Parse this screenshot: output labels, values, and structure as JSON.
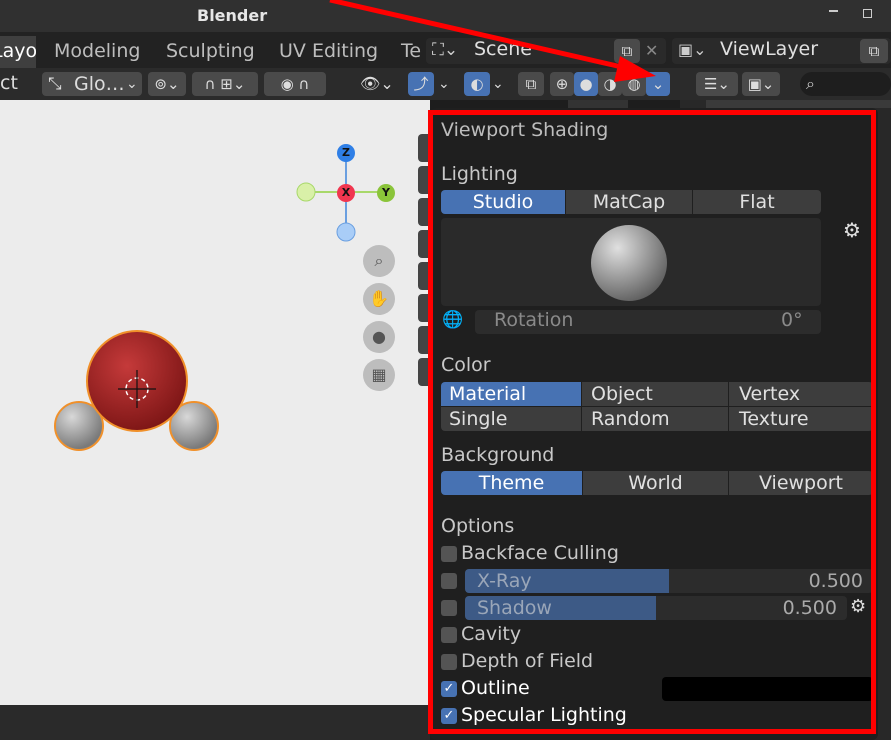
{
  "app": {
    "title": "Blender"
  },
  "workspaces": {
    "active_partial": "Layout",
    "tabs": [
      "Modeling",
      "Sculpting",
      "UV Editing",
      "Te"
    ]
  },
  "scene": {
    "name": "Scene",
    "view_layer": "ViewLayer"
  },
  "header": {
    "select_partial": "ct",
    "transform_orientation": "Glo…"
  },
  "gizmo": {
    "z": "Z",
    "x": "X",
    "y": "Y"
  },
  "popover": {
    "title": "Viewport Shading",
    "lighting": {
      "label": "Lighting",
      "options": [
        "Studio",
        "MatCap",
        "Flat"
      ],
      "selected": "Studio",
      "rotation_label": "Rotation",
      "rotation_value": "0°"
    },
    "color": {
      "label": "Color",
      "options_row1": [
        "Material",
        "Object",
        "Vertex"
      ],
      "options_row2": [
        "Single",
        "Random",
        "Texture"
      ],
      "selected": "Material"
    },
    "background": {
      "label": "Background",
      "options": [
        "Theme",
        "World",
        "Viewport"
      ],
      "selected": "Theme"
    },
    "options": {
      "label": "Options",
      "backface_culling": "Backface Culling",
      "xray_label": "X-Ray",
      "xray_value": "0.500",
      "xray_fraction": 0.5,
      "shadow_label": "Shadow",
      "shadow_value": "0.500",
      "shadow_fraction": 0.5,
      "cavity": "Cavity",
      "depth_of_field": "Depth of Field",
      "outline": "Outline",
      "outline_color": "#000000",
      "specular": "Specular Lighting"
    }
  },
  "colors": {
    "accent": "#4772b3",
    "annotation": "#ff0000"
  }
}
